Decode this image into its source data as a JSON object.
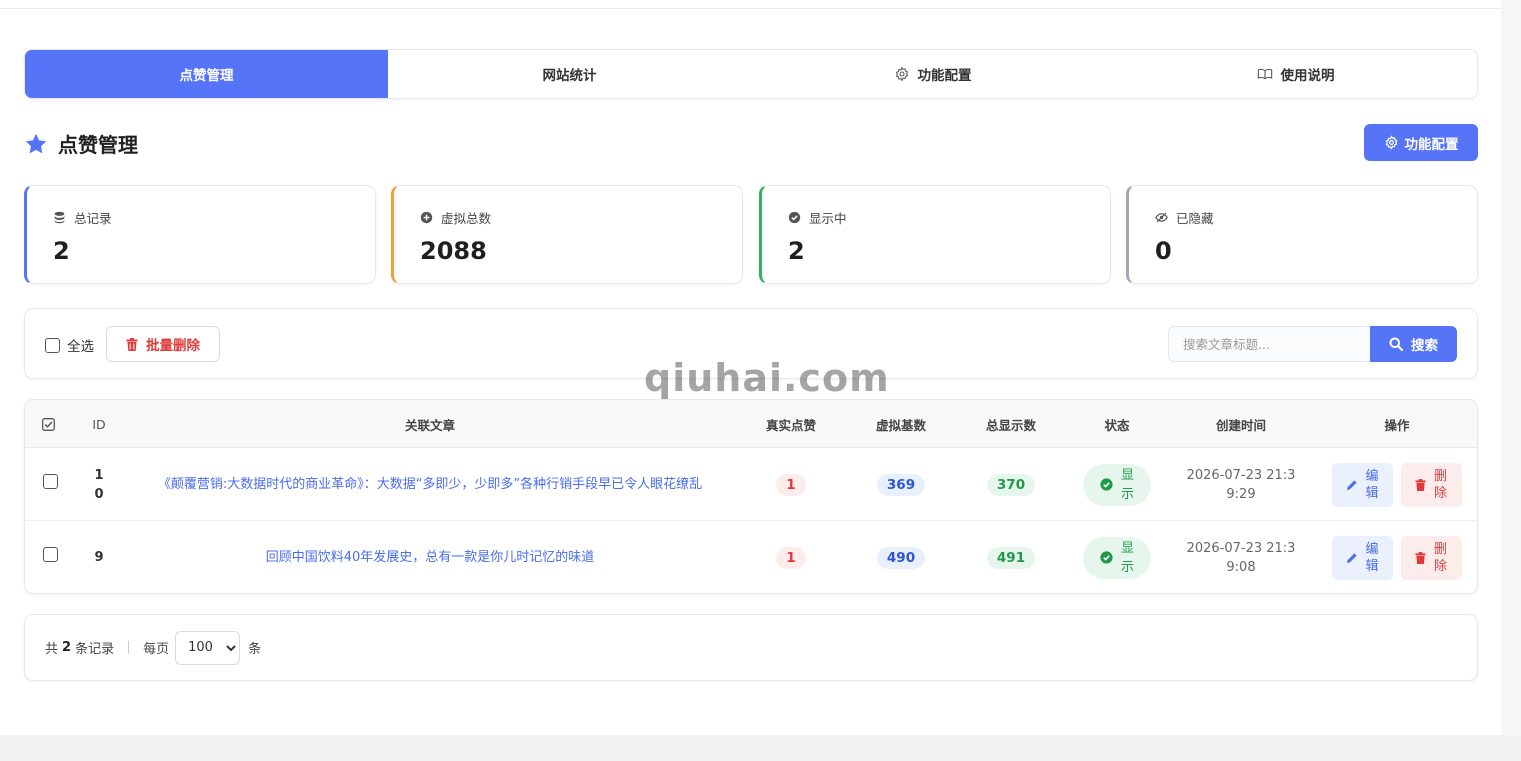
{
  "tabs": [
    {
      "label": "点赞管理",
      "icon": "",
      "active": true
    },
    {
      "label": "网站统计",
      "icon": "",
      "active": false
    },
    {
      "label": "功能配置",
      "icon": "gear-icon",
      "active": false
    },
    {
      "label": "使用说明",
      "icon": "book-icon",
      "active": false
    }
  ],
  "header": {
    "title": "点赞管理",
    "config_button": "功能配置"
  },
  "stats": [
    {
      "label": "总记录",
      "value": "2",
      "icon": "database-icon",
      "color": "#5574f7"
    },
    {
      "label": "虚拟总数",
      "value": "2088",
      "icon": "plus-circle-icon",
      "color": "#f0a22e"
    },
    {
      "label": "显示中",
      "value": "2",
      "icon": "check-circle-icon",
      "color": "#2fb35a"
    },
    {
      "label": "已隐藏",
      "value": "0",
      "icon": "eye-slash-icon",
      "color": "#a0a6b2"
    }
  ],
  "toolbar": {
    "select_all": "全选",
    "bulk_delete": "批量删除",
    "search_placeholder": "搜索文章标题...",
    "search_button": "搜索"
  },
  "table": {
    "headers": [
      "ID",
      "关联文章",
      "真实点赞",
      "虚拟基数",
      "总显示数",
      "状态",
      "创建时间",
      "操作"
    ],
    "rows": [
      {
        "id": "10",
        "article": "《颠覆营销:大数据时代的商业革命》：大数据“多即少，少即多”各种行销手段早已令人眼花缭乱",
        "real": "1",
        "virtual": "369",
        "total": "370",
        "status": "显示",
        "created": "2026-07-23 21:39:29",
        "edit": "编辑",
        "delete": "删除"
      },
      {
        "id": "9",
        "article": "回顾中国饮料40年发展史，总有一款是你儿时记忆的味道",
        "real": "1",
        "virtual": "490",
        "total": "491",
        "status": "显示",
        "created": "2026-07-23 21:39:08",
        "edit": "编辑",
        "delete": "删除"
      }
    ]
  },
  "footer": {
    "total_prefix": "共",
    "total_count": "2",
    "total_suffix": "条记录",
    "per_page_label": "每页",
    "per_page_value": "100",
    "per_page_unit": "条"
  },
  "watermark": "qiuhai.com",
  "colors": {
    "accent": "#5574f7",
    "danger": "#e03b3b",
    "success": "#1f9a4a"
  }
}
